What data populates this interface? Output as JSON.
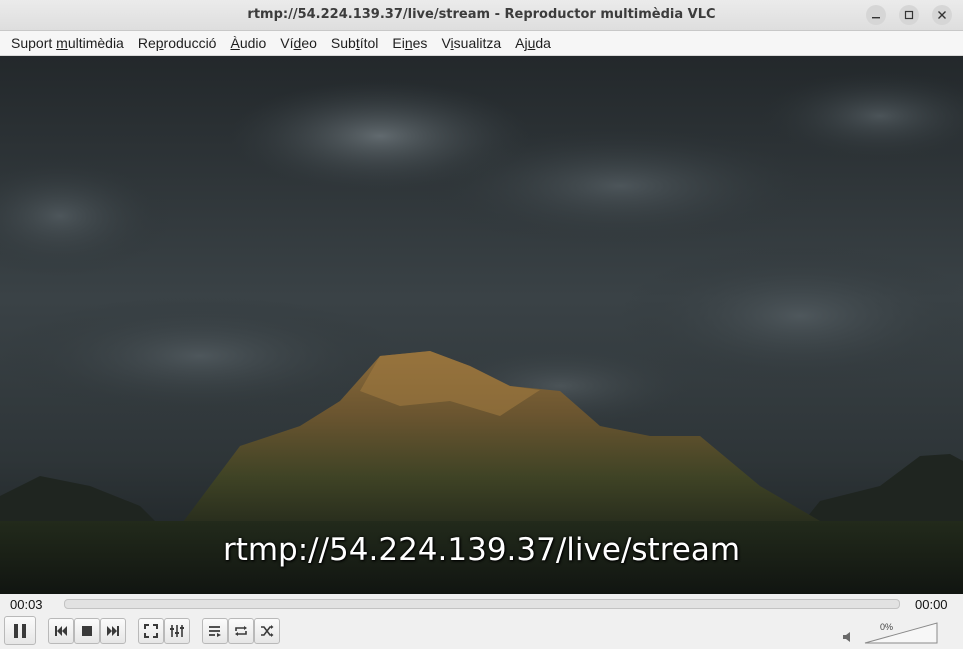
{
  "window": {
    "title": "rtmp://54.224.139.37/live/stream - Reproductor multimèdia VLC"
  },
  "menu": [
    {
      "pre": "Suport ",
      "key": "m",
      "post": "ultimèdia"
    },
    {
      "pre": "Re",
      "key": "p",
      "post": "roducció"
    },
    {
      "pre": "",
      "key": "À",
      "post": "udio"
    },
    {
      "pre": "Ví",
      "key": "d",
      "post": "eo"
    },
    {
      "pre": "Sub",
      "key": "t",
      "post": "ítol"
    },
    {
      "pre": "Ei",
      "key": "n",
      "post": "es"
    },
    {
      "pre": "V",
      "key": "i",
      "post": "sualitza"
    },
    {
      "pre": "Aj",
      "key": "u",
      "post": "da"
    }
  ],
  "video": {
    "overlay_text": "rtmp://54.224.139.37/live/stream"
  },
  "playback": {
    "elapsed": "00:03",
    "remaining": "00:00",
    "progress": 0
  },
  "volume": {
    "label": "0%",
    "level": 0
  },
  "icons": {
    "pause": "pause-icon",
    "previous": "previous-icon",
    "stop": "stop-icon",
    "next": "next-icon",
    "fullscreen": "fullscreen-icon",
    "extended": "extended-settings-icon",
    "playlist": "playlist-icon",
    "loop": "loop-icon",
    "shuffle": "shuffle-icon",
    "speaker": "speaker-icon"
  }
}
